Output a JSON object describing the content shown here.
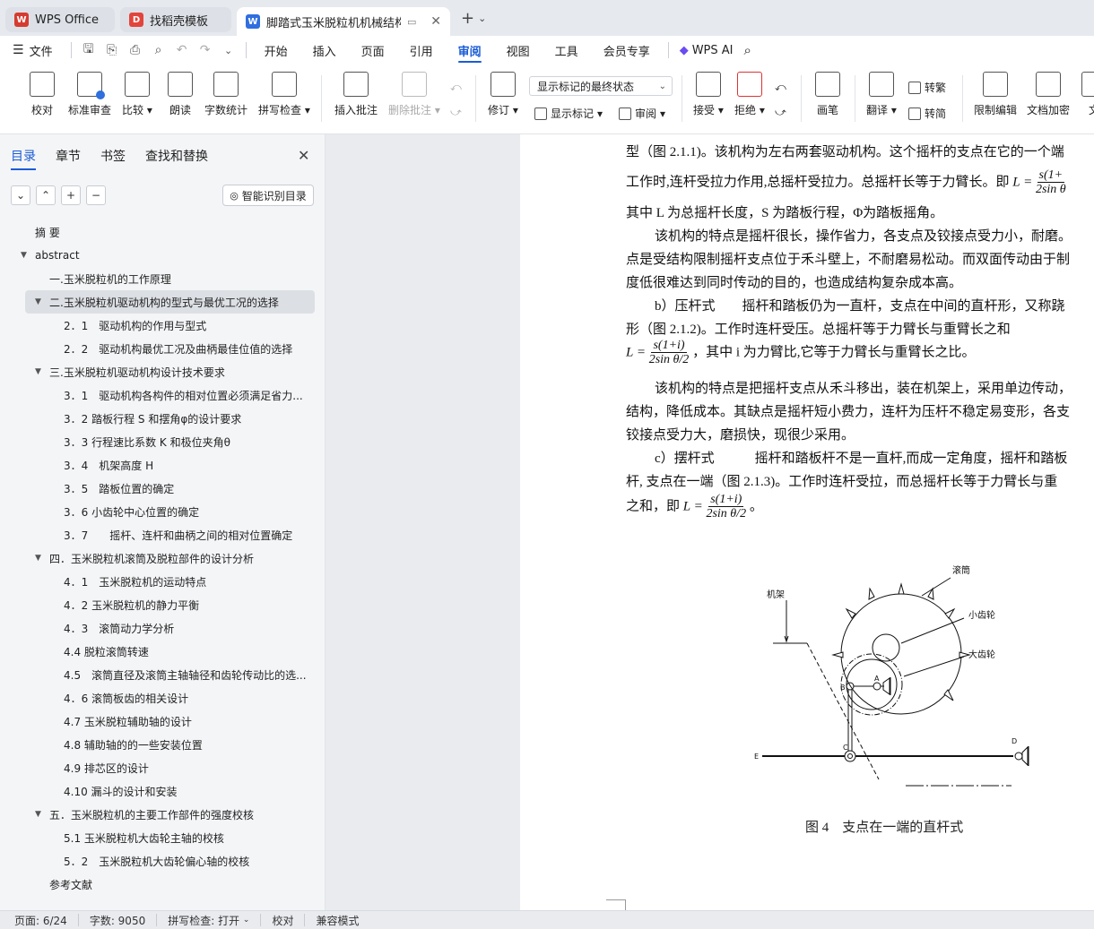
{
  "tabs": [
    {
      "label": "WPS Office",
      "icon": "wps-logo-icon",
      "color": "#d63b2f"
    },
    {
      "label": "找稻壳模板",
      "icon": "docer-logo-icon",
      "color": "#e2453c"
    },
    {
      "label": "脚踏式玉米脱粒机机械结构设计",
      "icon": "word-doc-icon",
      "color": "#2f6fde"
    }
  ],
  "menu": {
    "file": "文件",
    "items": [
      "开始",
      "插入",
      "页面",
      "引用",
      "审阅",
      "视图",
      "工具",
      "会员专享"
    ],
    "active": "审阅",
    "wps_ai": "WPS AI"
  },
  "ribbon": {
    "proofread": "校对",
    "std_review": "标准审查",
    "compare": "比较",
    "read_aloud": "朗读",
    "word_count": "字数统计",
    "spell_check": "拼写检查",
    "insert_comment": "插入批注",
    "delete_comment": "删除批注",
    "revise": "修订",
    "markup_select": "显示标记的最终状态",
    "show_markup": "显示标记",
    "review": "审阅",
    "accept": "接受",
    "reject": "拒绝",
    "ink": "画笔",
    "translate": "翻译",
    "to_traditional": "转繁",
    "to_simplified": "转简",
    "restrict_edit": "限制编辑",
    "doc_encrypt": "文档加密",
    "doc_more": "文"
  },
  "sidebar": {
    "tabs": [
      "目录",
      "章节",
      "书签",
      "查找和替换"
    ],
    "active_tab": "目录",
    "smart_toc": "智能识别目录",
    "toc": [
      {
        "level": 1,
        "text": "摘 要"
      },
      {
        "level": 1,
        "text": "abstract",
        "expanded": true
      },
      {
        "level": 2,
        "text": "一.玉米脱粒机的工作原理"
      },
      {
        "level": 2,
        "text": "二.玉米脱粒机驱动机构的型式与最优工况的选择",
        "expanded": true,
        "selected": true
      },
      {
        "level": 3,
        "text": "2．1　驱动机构的作用与型式"
      },
      {
        "level": 3,
        "text": "2．2　驱动机构最优工况及曲柄最佳位值的选择"
      },
      {
        "level": 2,
        "text": "三.玉米脱粒机驱动机构设计技术要求",
        "expanded": true
      },
      {
        "level": 3,
        "text": "3．1　驱动机构各构件的相对位置必须满足省力..."
      },
      {
        "level": 3,
        "text": "3．2 踏板行程 S 和摆角φ的设计要求"
      },
      {
        "level": 3,
        "text": "3．3 行程速比系数 K 和极位夹角θ"
      },
      {
        "level": 3,
        "text": "3．4　机架高度 H"
      },
      {
        "level": 3,
        "text": "3．5　踏板位置的确定"
      },
      {
        "level": 3,
        "text": "3．6 小齿轮中心位置的确定"
      },
      {
        "level": 3,
        "text": "3．7　　摇杆、连杆和曲柄之间的相对位置确定"
      },
      {
        "level": 2,
        "text": "四．玉米脱粒机滚筒及脱粒部件的设计分析",
        "expanded": true
      },
      {
        "level": 3,
        "text": "4．1　玉米脱粒机的运动特点"
      },
      {
        "level": 3,
        "text": "4．2 玉米脱粒机的静力平衡"
      },
      {
        "level": 3,
        "text": "4．3　滚筒动力学分析"
      },
      {
        "level": 3,
        "text": "4.4 脱粒滚筒转速"
      },
      {
        "level": 3,
        "text": "4.5　滚筒直径及滚筒主轴轴径和齿轮传动比的选..."
      },
      {
        "level": 3,
        "text": "4．6 滚筒板齿的相关设计"
      },
      {
        "level": 3,
        "text": "4.7 玉米脱粒辅助轴的设计"
      },
      {
        "level": 3,
        "text": "4.8 辅助轴的的一些安装位置"
      },
      {
        "level": 3,
        "text": "4.9 排芯区的设计"
      },
      {
        "level": 3,
        "text": "4.10 漏斗的设计和安装"
      },
      {
        "level": 2,
        "text": "五．玉米脱粒机的主要工作部件的强度校核",
        "expanded": true
      },
      {
        "level": 3,
        "text": "5.1 玉米脱粒机大齿轮主轴的校核"
      },
      {
        "level": 3,
        "text": "5．2　玉米脱粒机大齿轮偏心轴的校核"
      },
      {
        "level": 2,
        "text": "参考文献"
      }
    ]
  },
  "document": {
    "lines": [
      "型（图 2.1.1)。该机构为左右两套驱动机构。这个摇杆的支点在它的一个端",
      "工作时,连杆受拉力作用,总摇杆受拉力。总摇杆长等于力臂长。即",
      "其中 L 为总摇杆长度，S 为踏板行程，Φ为踏板摇角。",
      "该机构的特点是摇杆很长，操作省力，各支点及铰接点受力小，耐磨。",
      "点是受结构限制摇杆支点位于禾斗壁上，不耐磨易松动。而双面传动由于制",
      "度低很难达到同时传动的目的，也造成结构复杂成本高。",
      "b）压杆式　　摇杆和踏板仍为一直杆，支点在中间的直杆形，又称跷",
      "形（图 2.1.2)。工作时连杆受压。总摇杆等于力臂长与重臂长之和",
      "，其中 i 为力臂比,它等于力臂长与重臂长之比。",
      "该机构的特点是把摇杆支点从禾斗移出，装在机架上，采用单边传动，",
      "结构，降低成本。其缺点是摇杆短小费力，连杆为压杆不稳定易变形，各支",
      "铰接点受力大，磨损快，现很少采用。",
      "c）摆杆式　　　摇杆和踏板杆不是一直杆,而成一定角度，摇杆和踏板",
      "杆, 支点在一端（图 2.1.3)。工作时连杆受拉，而总摇杆长等于力臂长与重",
      "之和，即"
    ],
    "formula_L": "L =",
    "formula_num": "s(1+i)",
    "formula_num_trunc": "s(1+",
    "formula_den": "2sin θ/2",
    "formula_den_trunc": "2sin θ",
    "figure_labels": {
      "frame": "机架",
      "drum": "滚筒",
      "small_gear": "小齿轮",
      "big_gear": "大齿轮",
      "A": "A",
      "B": "B",
      "C": "C",
      "D": "D",
      "E": "E"
    },
    "caption": "图 4　支点在一端的直杆式"
  },
  "status": {
    "page": "页面: 6/24",
    "words": "字数: 9050",
    "spell": "拼写检查: 打开",
    "proof": "校对",
    "compat": "兼容模式"
  },
  "colors": {
    "accent": "#1a5cd6",
    "panel_bg": "#f4f5f7",
    "chrome_bg": "#e6e9ee"
  }
}
